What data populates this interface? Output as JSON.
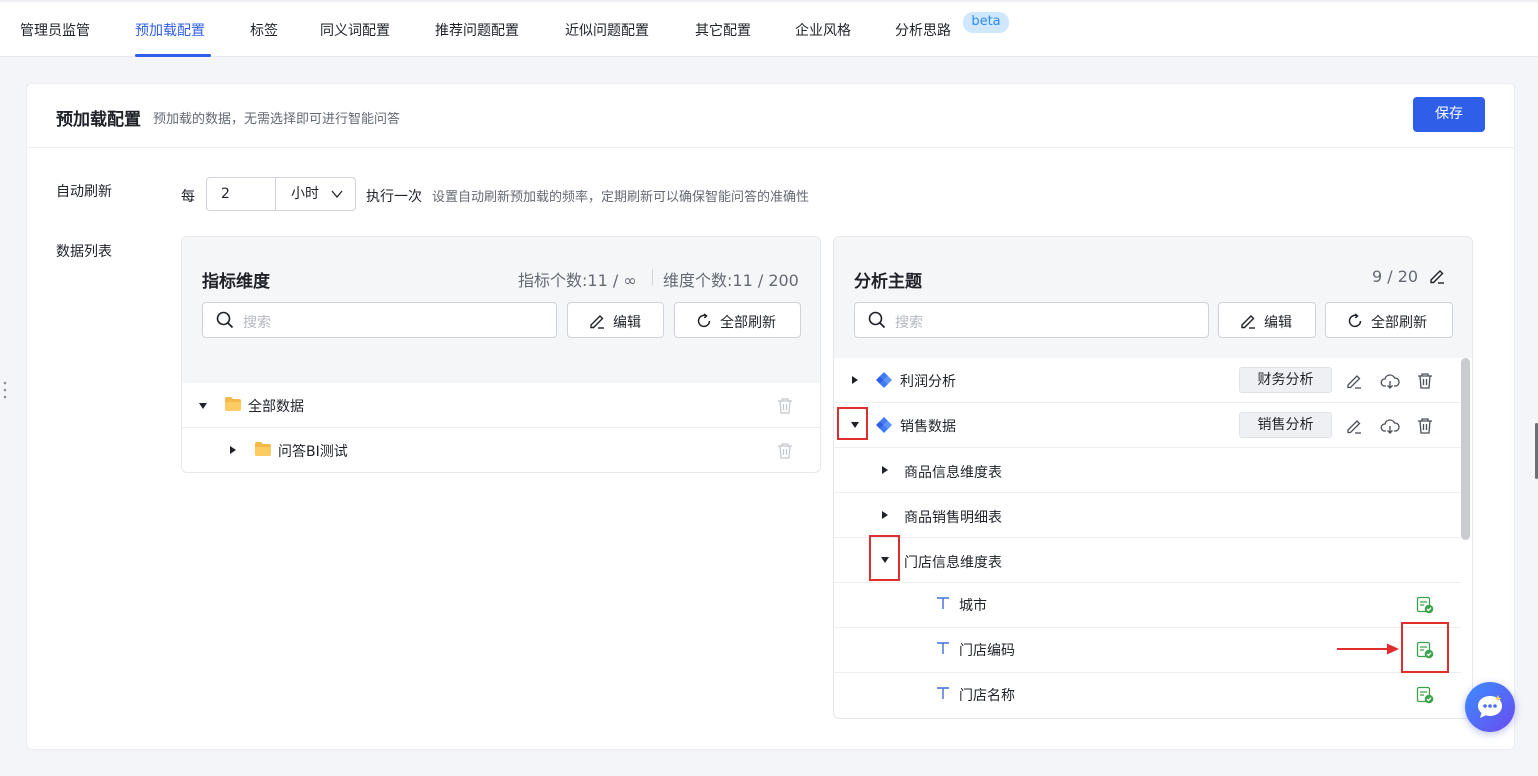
{
  "tabs": [
    {
      "label": "管理员监管",
      "active": false
    },
    {
      "label": "预加载配置",
      "active": true
    },
    {
      "label": "标签",
      "active": false
    },
    {
      "label": "同义词配置",
      "active": false
    },
    {
      "label": "推荐问题配置",
      "active": false
    },
    {
      "label": "近似问题配置",
      "active": false
    },
    {
      "label": "其它配置",
      "active": false
    },
    {
      "label": "企业风格",
      "active": false
    },
    {
      "label": "分析思路",
      "active": false
    }
  ],
  "beta_badge": "beta",
  "header": {
    "title": "预加载配置",
    "description": "预加载的数据，无需选择即可进行智能问答",
    "save_label": "保存"
  },
  "auto_refresh": {
    "label": "自动刷新",
    "prefix": "每",
    "value": "2",
    "unit": "小时",
    "suffix": "执行一次",
    "hint": "设置自动刷新预加载的频率，定期刷新可以确保智能问答的准确性"
  },
  "data_list_label": "数据列表",
  "metrics_panel": {
    "title": "指标维度",
    "metric_count": "指标个数:11 / ∞",
    "dimension_count": "维度个数:11 / 200",
    "search_placeholder": "搜索",
    "edit_label": "编辑",
    "refresh_all_label": "全部刷新",
    "tree": [
      {
        "label": "全部数据",
        "expanded": true
      },
      {
        "label": "问答BI测试",
        "expanded": false
      }
    ]
  },
  "topics_panel": {
    "title": "分析主题",
    "count": "9 / 20",
    "search_placeholder": "搜索",
    "edit_label": "编辑",
    "refresh_all_label": "全部刷新",
    "topics": [
      {
        "label": "利润分析",
        "tag": "财务分析",
        "expanded": false
      },
      {
        "label": "销售数据",
        "tag": "销售分析",
        "expanded": true
      }
    ],
    "tables": [
      {
        "label": "商品信息维度表",
        "expanded": false
      },
      {
        "label": "商品销售明细表",
        "expanded": false
      },
      {
        "label": "门店信息维度表",
        "expanded": true
      }
    ],
    "fields": [
      {
        "label": "城市"
      },
      {
        "label": "门店编码"
      },
      {
        "label": "门店名称"
      }
    ]
  },
  "colors": {
    "accent": "#2f5fe8",
    "highlight": "#e02e2e",
    "success": "#3aa34a"
  }
}
